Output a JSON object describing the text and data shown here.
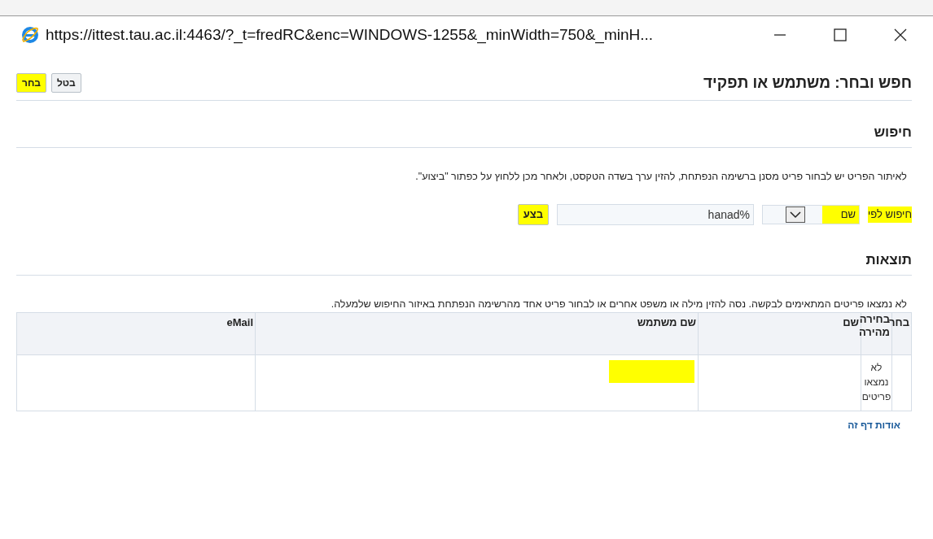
{
  "window": {
    "url": "https://ittest.tau.ac.il:4463/?_t=fredRC&enc=WINDOWS-1255&_minWidth=750&_minH...",
    "controls": [
      {
        "kind": "minimize"
      },
      {
        "kind": "maximize"
      },
      {
        "kind": "close"
      }
    ]
  },
  "page": {
    "title": "חפש ובחר: משתמש או תפקיד",
    "buttons": [
      {
        "label": "בטל",
        "highlighted": false
      },
      {
        "label": "בחר",
        "highlighted": true
      }
    ]
  },
  "search": {
    "heading": "חיפוש",
    "instructions": "לאיתור הפריט יש לבחור פריט מסנן ברשימה הנפתחת, להזין ערך בשדה הטקסט, ולאחר מכן ללחוץ על כפתור \"ביצוע\".",
    "by_label": "חיפוש לפי",
    "by_value": "שם",
    "by_highlighted": true,
    "value": "hanad%",
    "go_button": {
      "label": "בצע",
      "highlighted": true
    }
  },
  "results": {
    "heading": "תוצאות",
    "message": "לא נמצאו פריטים המתאימים לבקשה. נסה להזין מילה או משפט אחרים או לבחור פריט אחד מהרשימה הנפתחת באיזור החיפוש שלמעלה.",
    "columns": [
      "בחר",
      "בחירה מהירה",
      "שם",
      "שם משתמש",
      "eMail"
    ],
    "row": [
      {
        "highlighted": false
      },
      {
        "text": "לא נמצאו פריטים",
        "highlighted": false
      },
      {
        "highlighted": false
      },
      {
        "highlighted": true
      },
      {
        "highlighted": false
      }
    ]
  },
  "footer_link": "אודות דף זה"
}
